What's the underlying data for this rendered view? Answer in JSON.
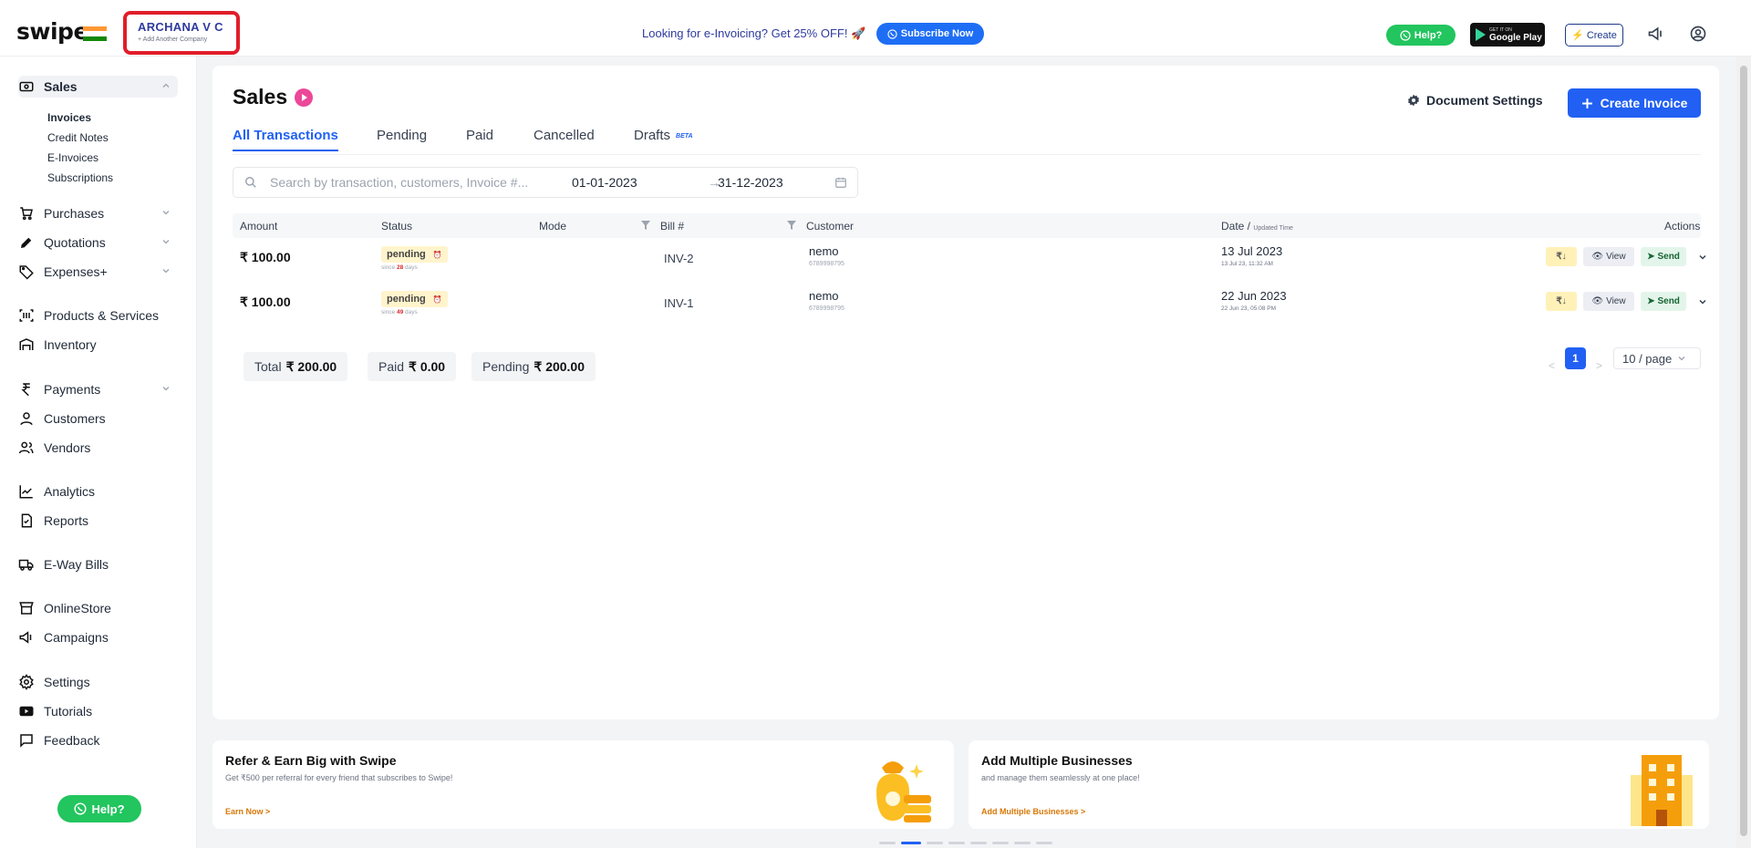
{
  "brand": {
    "logo_text": "swipe"
  },
  "company": {
    "name": "ARCHANA V C",
    "add_link": "+ Add Another Company"
  },
  "promo_bar": {
    "text": "Looking for e-Invoicing? Get 25% OFF! 🚀",
    "subscribe_label": "Subscribe Now"
  },
  "topbar": {
    "help_label": "Help?",
    "gplay_small": "GET IT ON",
    "gplay_big": "Google Play",
    "create_label": "Create"
  },
  "sidebar": {
    "sales": "Sales",
    "sales_sub": [
      "Invoices",
      "Credit Notes",
      "E-Invoices",
      "Subscriptions"
    ],
    "items": [
      "Purchases",
      "Quotations",
      "Expenses+",
      "Products & Services",
      "Inventory",
      "Payments",
      "Customers",
      "Vendors",
      "Analytics",
      "Reports",
      "E-Way Bills",
      "OnlineStore",
      "Campaigns",
      "Settings",
      "Tutorials",
      "Feedback"
    ],
    "help_label": "Help?"
  },
  "page": {
    "title": "Sales",
    "doc_settings_label": "Document Settings",
    "create_invoice_label": "Create Invoice",
    "tabs": [
      "All Transactions",
      "Pending",
      "Paid",
      "Cancelled",
      "Drafts"
    ],
    "beta_badge": "BETA"
  },
  "filters": {
    "search_placeholder": "Search by transaction, customers, Invoice #...",
    "date_start": "01-01-2023",
    "date_arrow": "→",
    "date_end": "31-12-2023"
  },
  "table": {
    "headers": {
      "amount": "Amount",
      "status": "Status",
      "mode": "Mode",
      "bill": "Bill #",
      "customer": "Customer",
      "date": "Date /",
      "date_small": "Updated Time",
      "actions": "Actions"
    },
    "rows": [
      {
        "amount": "₹ 100.00",
        "status": "pending",
        "since_pre": "since",
        "since_days": "28",
        "since_post": "days",
        "bill": "INV-2",
        "customer": "nemo",
        "phone": "6789998795",
        "date": "13 Jul 2023",
        "updated": "13 Jul 23, 11:32 AM"
      },
      {
        "amount": "₹ 100.00",
        "status": "pending",
        "since_pre": "since",
        "since_days": "49",
        "since_post": "days",
        "bill": "INV-1",
        "customer": "nemo",
        "phone": "6789998795",
        "date": "22 Jun 2023",
        "updated": "22 Jun 23, 05:08 PM"
      }
    ],
    "actions": {
      "rupee": "₹↓",
      "view": "View",
      "send": "Send"
    }
  },
  "summary": {
    "total_label": "Total",
    "total_value": "₹ 200.00",
    "paid_label": "Paid",
    "paid_value": "₹ 0.00",
    "pending_label": "Pending",
    "pending_value": "₹ 200.00"
  },
  "pagination": {
    "prev": "<",
    "page": "1",
    "next": ">",
    "page_size": "10 / page"
  },
  "promos": [
    {
      "title": "Refer & Earn Big with Swipe",
      "desc": "Get ₹500 per referral for every friend that subscribes to Swipe!",
      "link": "Earn Now >"
    },
    {
      "title": "Add Multiple Businesses",
      "desc": "and manage them seamlessly at one place!",
      "link": "Add Multiple Businesses >"
    }
  ],
  "colors": {
    "accent": "#2160f3",
    "brand_red": "#e11d2a",
    "pending_bg": "#fff4cc",
    "whatsapp": "#22c55e"
  }
}
